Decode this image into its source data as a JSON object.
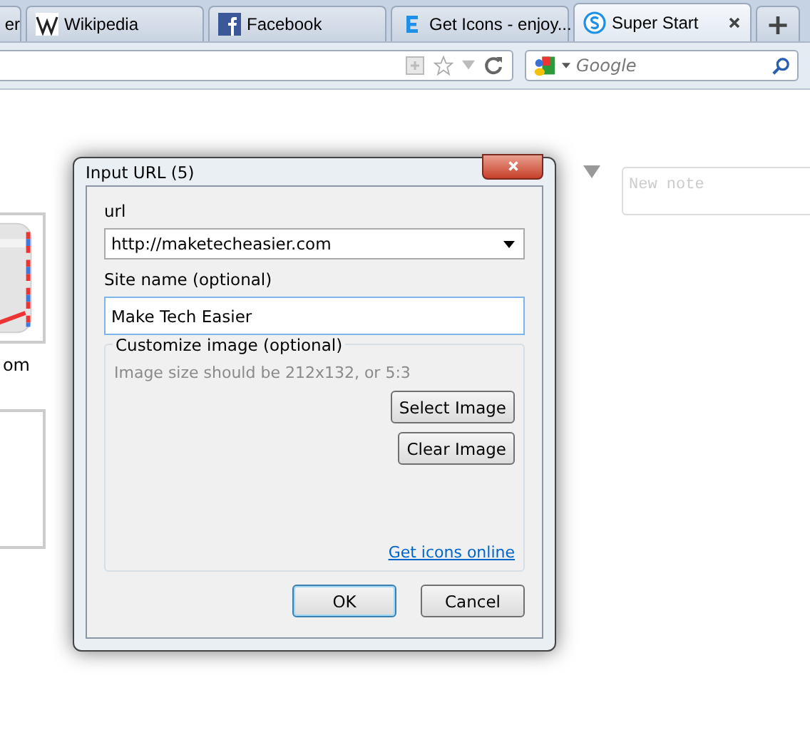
{
  "tabs": [
    {
      "title": "er",
      "selected": false
    },
    {
      "title": "Wikipedia",
      "selected": false
    },
    {
      "title": "Facebook",
      "selected": false
    },
    {
      "title": "Get Icons - enjoy...",
      "selected": false
    },
    {
      "title": "Super Start",
      "selected": true
    }
  ],
  "new_tab": "+",
  "search": {
    "placeholder": "Google"
  },
  "tiles": [
    {
      "kind": "picture",
      "label": "om"
    },
    {
      "kind": "empty"
    }
  ],
  "note": {
    "placeholder": "New note"
  },
  "dialog": {
    "title": "Input URL (5)",
    "url_label": "url",
    "url_value": "http://maketecheasier.com",
    "name_label": "Site name (optional)",
    "name_value": "Make Tech Easier",
    "group_legend": "Customize image (optional)",
    "hint": "Image size should be 212x132, or 5:3",
    "select_button": "Select Image",
    "clear_button": "Clear Image",
    "link": "Get icons online",
    "ok": "OK",
    "cancel": "Cancel"
  }
}
